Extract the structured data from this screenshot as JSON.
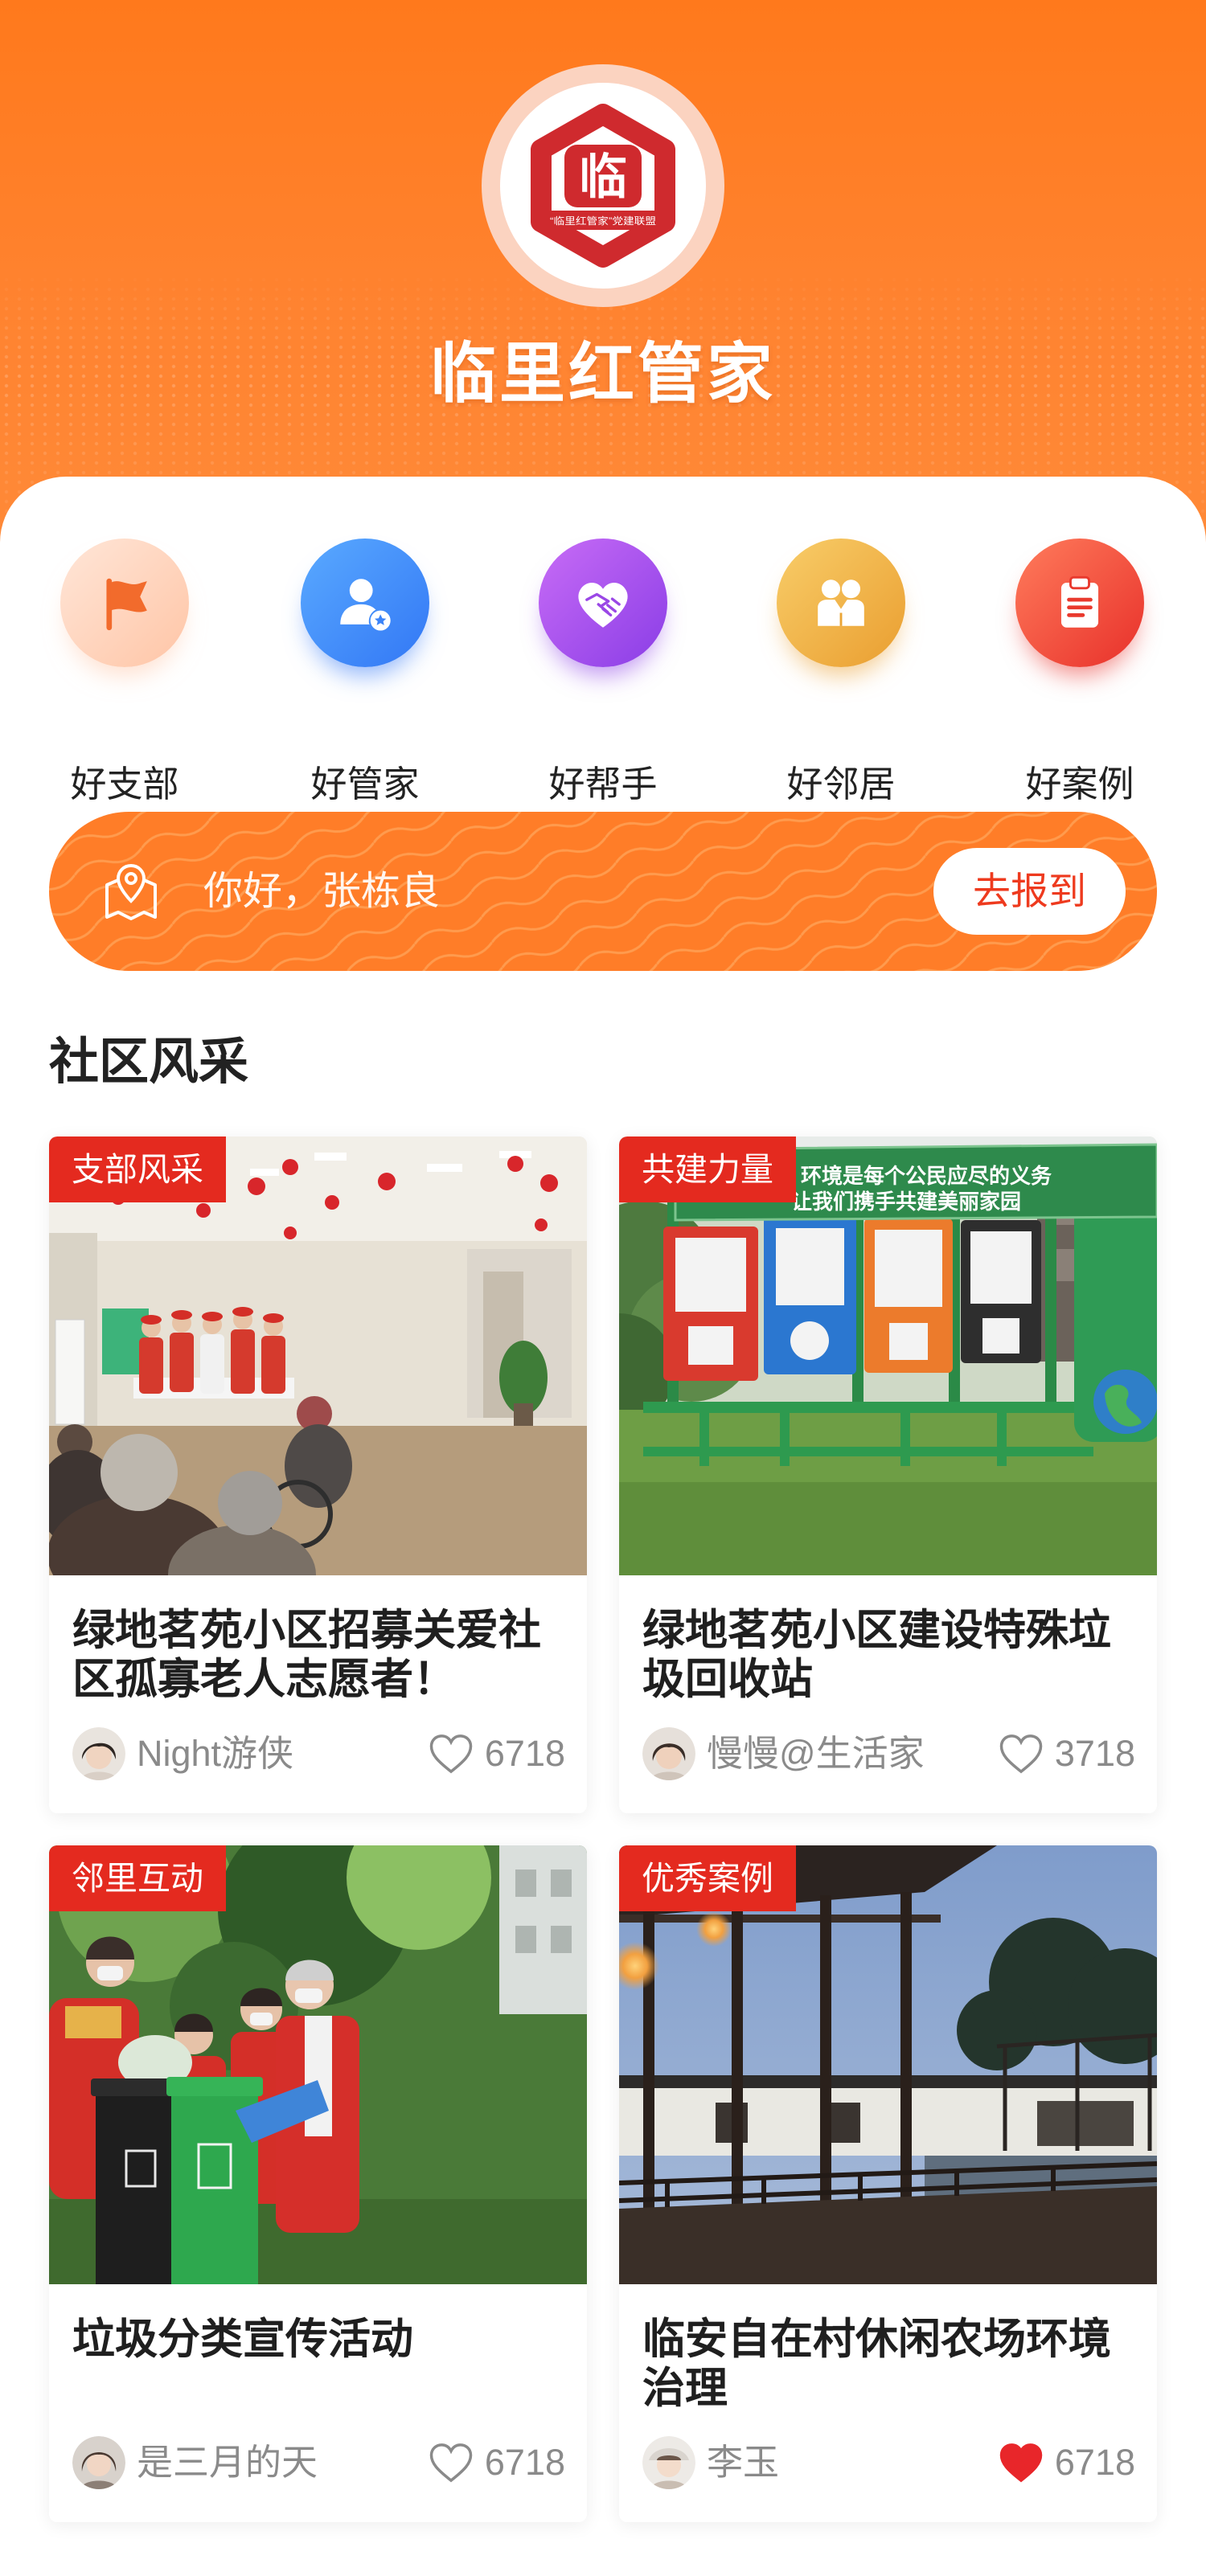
{
  "header": {
    "title": "临里红管家",
    "logo": {
      "glyph": "临",
      "caption": "“临里红管家”党建联盟"
    }
  },
  "quick_nav": [
    {
      "label": "好支部",
      "icon": "flag-icon",
      "color_from": "#FFE6D8",
      "color_to": "#FFC5A6"
    },
    {
      "label": "好管家",
      "icon": "person-badge-icon",
      "color_from": "#5AAAFF",
      "color_to": "#3277F5"
    },
    {
      "label": "好帮手",
      "icon": "heart-handshake-icon",
      "color_from": "#C86CF6",
      "color_to": "#8A3DE6"
    },
    {
      "label": "好邻居",
      "icon": "neighbors-icon",
      "color_from": "#F8CD69",
      "color_to": "#EA9E30"
    },
    {
      "label": "好案例",
      "icon": "clipboard-icon",
      "color_from": "#FF7C5C",
      "color_to": "#E8302A"
    }
  ],
  "checkin": {
    "icon": "location-map-icon",
    "greeting": "你好，张栋良",
    "button_label": "去报到"
  },
  "section_title": "社区风采",
  "posts": [
    {
      "tag": "支部风采",
      "title": "绿地茗苑小区招募关爱社区孤寡老人志愿者！",
      "author": "Night游侠",
      "likes": "6718",
      "liked": false
    },
    {
      "tag": "共建力量",
      "title": "绿地茗苑小区建设特殊垃圾回收站",
      "author": "慢慢@生活家",
      "likes": "3718",
      "liked": false,
      "photo_text": [
        "环境是每个公民应尽的义务",
        "让我们携手共建美丽家园"
      ]
    },
    {
      "tag": "邻里互动",
      "title": "垃圾分类宣传活动",
      "author": "是三月的天",
      "likes": "6718",
      "liked": false
    },
    {
      "tag": "优秀案例",
      "title": "临安自在村休闲农场环境治理",
      "author": "李玉",
      "likes": "6718",
      "liked": true
    }
  ],
  "theme": {
    "primary": "#FF7D28",
    "tag_background": "#E42A1F",
    "button_text": "#EE3A1E",
    "liked_heart": "#E8262A",
    "logo_red": "#CF2A2E"
  }
}
